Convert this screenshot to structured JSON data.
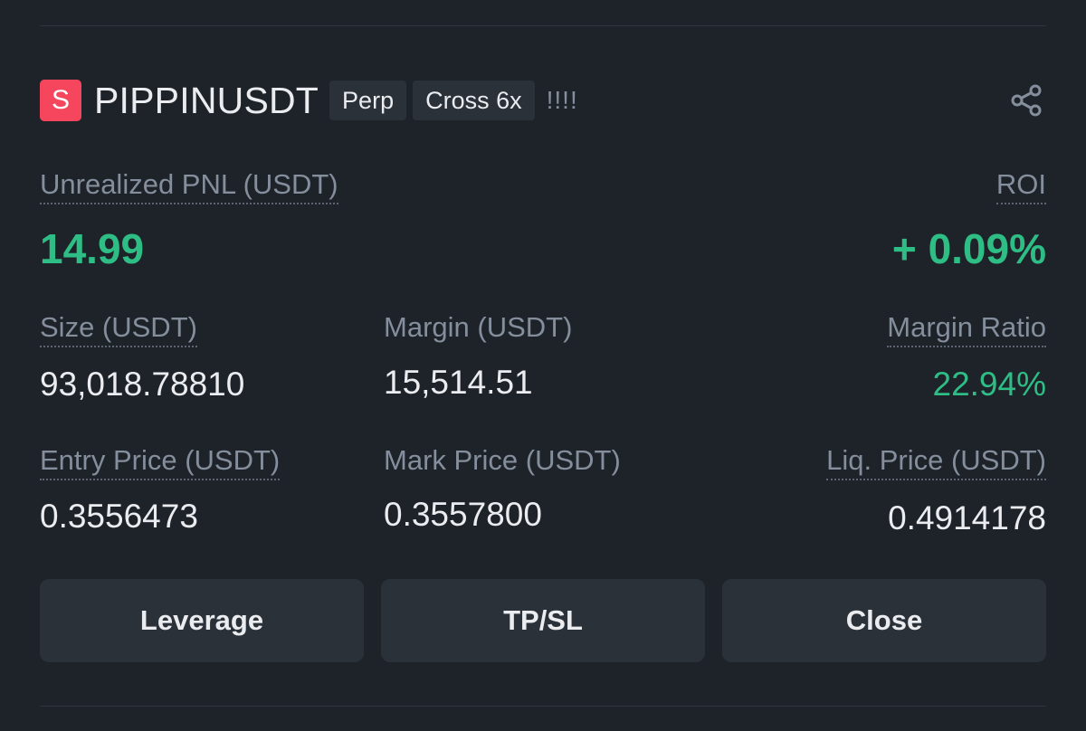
{
  "position": {
    "symbol_icon": "S",
    "symbol": "PIPPINUSDT",
    "tags": [
      "Perp",
      "Cross 6x"
    ],
    "leverage_bars": "!!!!",
    "share_icon": "share-icon",
    "accent_color": "#f6465d",
    "positive_color": "#2ebd85"
  },
  "pnl": {
    "label": "Unrealized PNL (USDT)",
    "value": "14.99"
  },
  "roi": {
    "label": "ROI",
    "value": "+ 0.09%"
  },
  "size": {
    "label": "Size (USDT)",
    "value": "93,018.78810"
  },
  "margin": {
    "label": "Margin (USDT)",
    "value": "15,514.51"
  },
  "margin_ratio": {
    "label": "Margin Ratio",
    "value": "22.94%"
  },
  "entry_price": {
    "label": "Entry Price (USDT)",
    "value": "0.3556473"
  },
  "mark_price": {
    "label": "Mark Price (USDT)",
    "value": "0.3557800"
  },
  "liq_price": {
    "label": "Liq. Price (USDT)",
    "value": "0.4914178"
  },
  "buttons": {
    "leverage": "Leverage",
    "tpsl": "TP/SL",
    "close": "Close"
  }
}
